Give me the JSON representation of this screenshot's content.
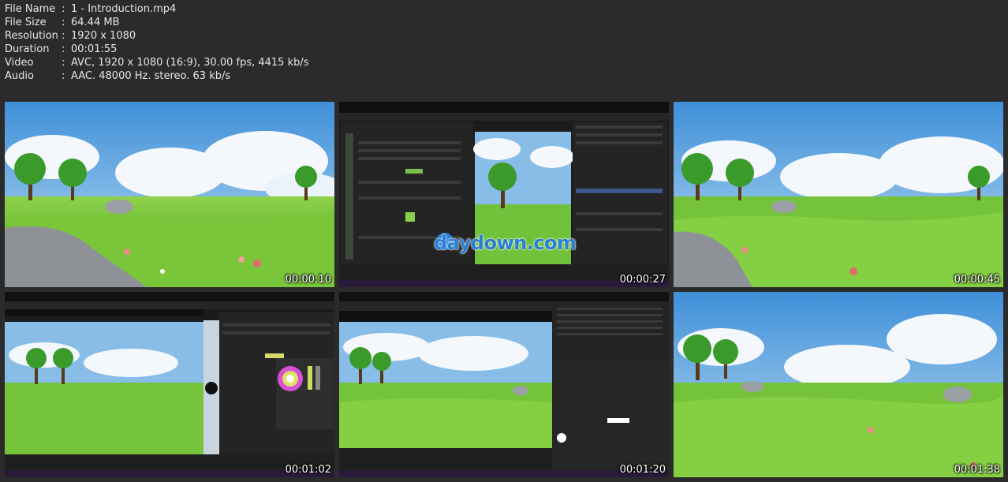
{
  "file_info": [
    {
      "key": "File Name",
      "value": "1 - Introduction.mp4"
    },
    {
      "key": "File Size",
      "value": "64.44 MB"
    },
    {
      "key": "Resolution",
      "value": "1920 x 1080"
    },
    {
      "key": "Duration",
      "value": "00:01:55"
    },
    {
      "key": "Video",
      "value": "AVC, 1920 x 1080 (16:9), 30.00 fps, 4415 kb/s"
    },
    {
      "key": "Audio",
      "value": "AAC. 48000 Hz. stereo. 63 kb/s"
    }
  ],
  "separator": ":",
  "thumbnails": [
    {
      "timestamp": "00:00:10",
      "kind": "scene"
    },
    {
      "timestamp": "00:00:27",
      "kind": "editor",
      "watermark": "daydown.com"
    },
    {
      "timestamp": "00:00:45",
      "kind": "scene"
    },
    {
      "timestamp": "00:01:02",
      "kind": "editor"
    },
    {
      "timestamp": "00:01:20",
      "kind": "editor"
    },
    {
      "timestamp": "00:01:38",
      "kind": "scene"
    }
  ],
  "colors": {
    "background": "#2b2b2b",
    "sky": "#87b8e6",
    "grass": "#6fc23a",
    "watermark": "#2a7fd4"
  }
}
